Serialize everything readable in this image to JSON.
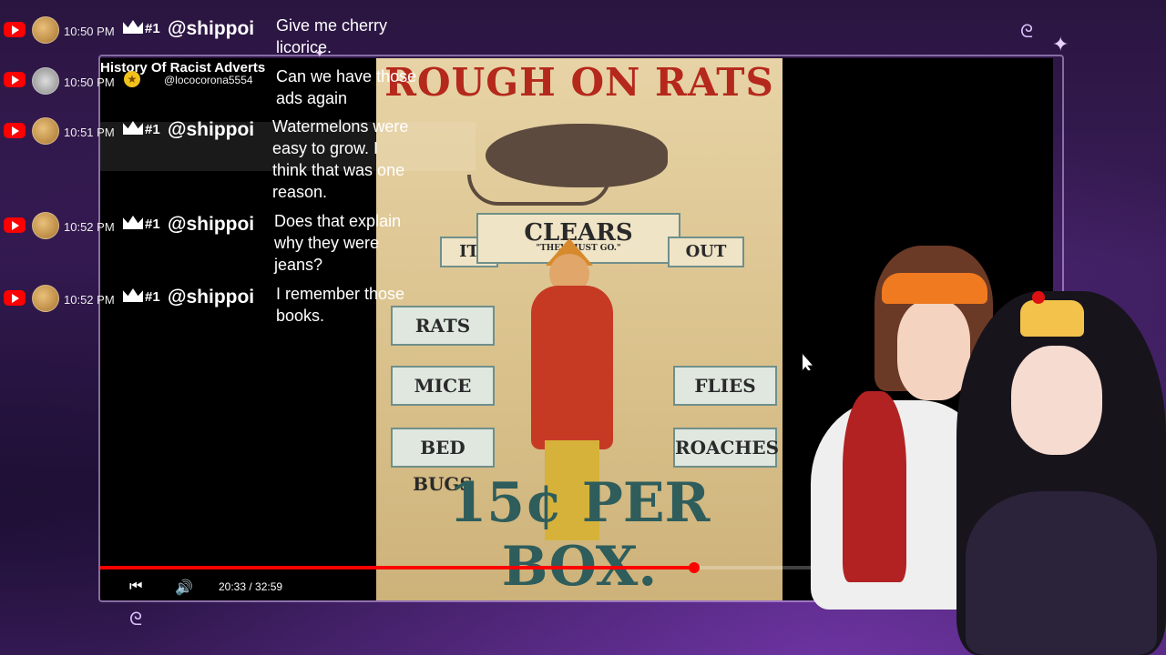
{
  "video": {
    "title": "History Of Racist Adverts",
    "time_current": "20:33",
    "time_total": "32:59",
    "time_display": "20:33 / 32:59",
    "progress": 0.6237
  },
  "poster": {
    "title": "ROUGH ON RATS",
    "clears": "CLEARS",
    "subtitle": "\"THEY MUST GO.\"",
    "it": "IT",
    "out": "OUT",
    "left_banners": [
      "RATS",
      "MICE",
      "BED BUGS"
    ],
    "right_banners": [
      "FLIES",
      "ROACHES"
    ],
    "price": "15¢ PER BOX."
  },
  "chat": {
    "messages": [
      {
        "time": "10:50 PM",
        "badge": "#1",
        "user": "@shippoi",
        "text_lines": [
          "Give me cherry",
          "licorice."
        ]
      },
      {
        "time": "10:50 PM",
        "user": "@lococorona5554",
        "text_lines": [
          "Can we have those",
          "ads again"
        ]
      },
      {
        "time": "10:51 PM",
        "badge": "#1",
        "user": "@shippoi",
        "text_lines": [
          "Watermelons were",
          "easy to grow. I",
          "think that was one",
          "reason."
        ]
      },
      {
        "time": "10:52 PM",
        "badge": "#1",
        "user": "@shippoi",
        "text_lines": [
          "Does that explain",
          "why they were",
          "jeans?"
        ]
      },
      {
        "time": "10:52 PM",
        "badge": "#1",
        "user": "@shippoi",
        "text_lines": [
          "I remember those",
          "books."
        ]
      }
    ]
  },
  "icons": {
    "platform": "youtube-icon",
    "badge": "crown-icon",
    "play": "skip-back-icon",
    "volume": "volume-icon"
  },
  "colors": {
    "accent": "#ff0000",
    "background": "#3b1d5a"
  }
}
